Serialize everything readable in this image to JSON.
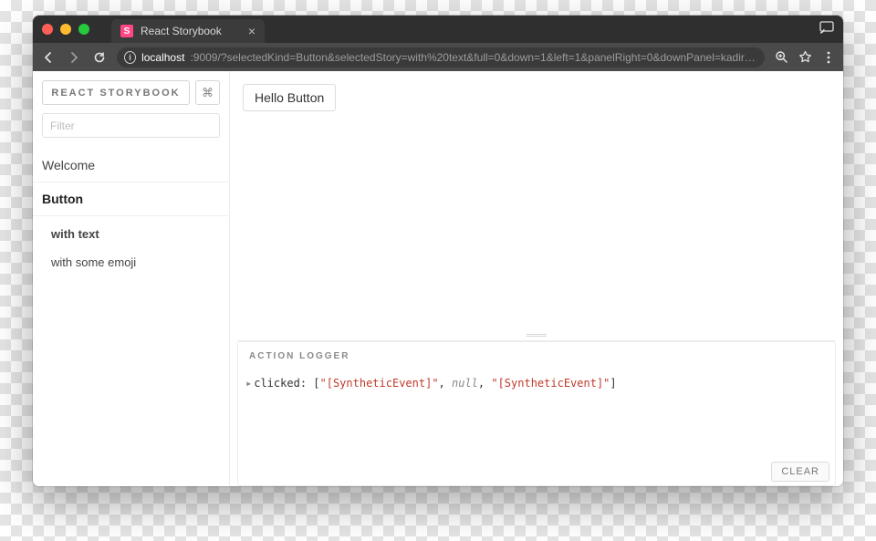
{
  "browser": {
    "tab_title": "React Storybook",
    "url_host": "localhost",
    "url_path": ":9009/?selectedKind=Button&selectedStory=with%20text&full=0&down=1&left=1&panelRight=0&downPanel=kadirahq%2Fst…"
  },
  "sidebar": {
    "brand": "REACT STORYBOOK",
    "shortcut_glyph": "⌘",
    "filter_placeholder": "Filter",
    "kinds": [
      {
        "label": "Welcome",
        "active": false
      },
      {
        "label": "Button",
        "active": true
      }
    ],
    "stories": [
      {
        "label": "with text",
        "active": true
      },
      {
        "label": "with some emoji",
        "active": false
      }
    ]
  },
  "preview": {
    "button_label": "Hello Button"
  },
  "panel": {
    "title": "ACTION LOGGER",
    "clear_label": "CLEAR",
    "log": {
      "name": "clicked",
      "open": "[",
      "close": "]",
      "arg0": "\"[SyntheticEvent]\"",
      "arg1": "null",
      "arg2": "\"[SyntheticEvent]\""
    }
  }
}
